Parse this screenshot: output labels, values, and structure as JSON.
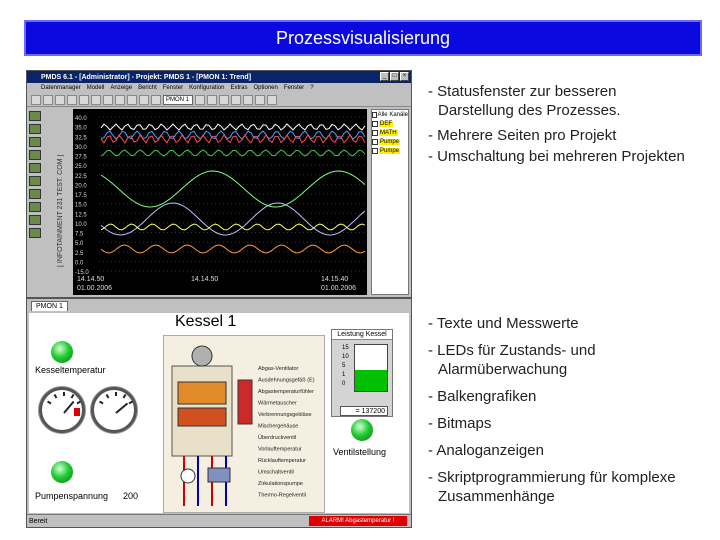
{
  "title": "Prozessvisualisierung",
  "bullets_top": [
    {
      "line1": "- Statusfenster zur besseren",
      "line2": "Darstellung des Prozesses."
    },
    {
      "line1": "- Mehrere Seiten pro Projekt",
      "line2": ""
    },
    {
      "line1": "- Umschaltung bei mehreren Projekten",
      "line2": ""
    }
  ],
  "bullets_bottom": [
    {
      "line1": "- Texte und Messwerte",
      "line2": ""
    },
    {
      "line1": "- LEDs für Zustands- und",
      "line2": "Alarmüberwachung"
    },
    {
      "line1": "- Balkengrafiken",
      "line2": ""
    },
    {
      "line1": "- Bitmaps",
      "line2": ""
    },
    {
      "line1": "- Analoganzeigen",
      "line2": ""
    },
    {
      "line1": "- Skriptprogrammierung für komplexe",
      "line2": "Zusammenhänge"
    }
  ],
  "screenshot1": {
    "window_title": "PMDS 6.1 - [Administrator] - Projekt: PMDS 1 - [PMON 1: Trend]",
    "menu": [
      "Datenmanager",
      "Modell",
      "Anzeige",
      "Bericht",
      "Fenster",
      "Konfiguration",
      "Extras",
      "Optionen",
      "Fenster",
      "?"
    ],
    "toolbar_select": "PMON 1",
    "vertical_label": "[ INFOTAINMENT 231 TEST. COM ]",
    "y_ticks": [
      "40.0",
      "35.0",
      "32.5",
      "30.0",
      "27.5",
      "25.0",
      "22.5",
      "20.0",
      "17.5",
      "15.0",
      "12.5",
      "10.0",
      "7.5",
      "5.0",
      "2.5",
      "0.0",
      "-15.0"
    ],
    "x_ticks": [
      {
        "time": "14.14.50",
        "date": "01.00.2006"
      },
      {
        "time": "14.14.50",
        "date": ""
      },
      {
        "time": "14.15.40",
        "date": "01.00.2006"
      }
    ],
    "tree_items": [
      {
        "label": "Alle Kanäle"
      },
      {
        "label": "DEF"
      },
      {
        "label": "MATH"
      },
      {
        "label": "Pumpe"
      },
      {
        "label": "Pumpe"
      }
    ]
  },
  "screenshot2": {
    "tab": "PMON 1",
    "heading": "Kessel 1",
    "label_temp": "Kesseltemperatur",
    "label_pump": "Pumpenspannung",
    "pump_value": "200",
    "label_valve": "Ventilstellung",
    "diagram_labels": [
      "Abgas-Ventilator",
      "Ausdehnungsgefäß (E)",
      "Abgastemperaturfühler",
      "Wärmetauscher",
      "Verbrennungsgebläse",
      "Mischergehäuse",
      "Überdruckventil",
      "Vorlauftemperatur",
      "Rücklauftemperatur",
      "Umschaltventil",
      "Zirkulationspumpe",
      "Thermo-Regelventil"
    ],
    "bar_title": "Leistung Kessel",
    "bar_ticks": [
      "15",
      "10",
      "5",
      "1",
      "0"
    ],
    "bar_fill_percent": 45,
    "bar_value": "= 137200",
    "status_left": "Bereit",
    "alarm_text": "ALARM! Abgastemperatur !"
  }
}
